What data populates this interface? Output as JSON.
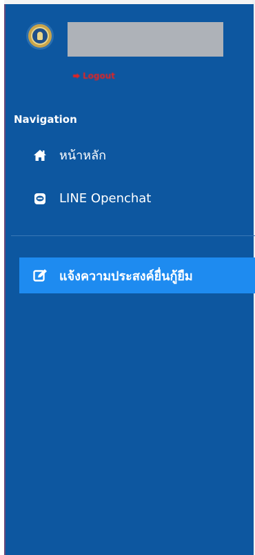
{
  "header": {
    "logout_label": "Logout"
  },
  "navigation": {
    "heading": "Navigation",
    "items": [
      {
        "label": "หน้าหลัก",
        "icon": "home-icon"
      },
      {
        "label": "LINE Openchat",
        "icon": "line-chat-icon"
      }
    ],
    "active_item": {
      "label": "แจ้งความประสงค์ยื่นกู้ยืม",
      "icon": "edit-icon"
    }
  },
  "colors": {
    "sidebar_bg": "#0d57a0",
    "active_bg": "#1e8bf0",
    "logout_red": "#e02424"
  }
}
